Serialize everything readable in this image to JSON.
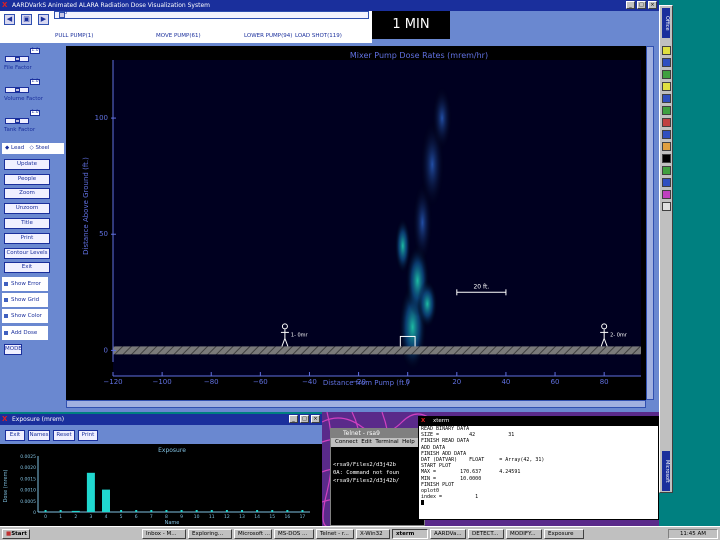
{
  "app": {
    "title": "AARDVarkS Animated ALARA Radiation Dose Visualization System",
    "time_display": "1 MIN",
    "toolbar_icons": [
      "rewind-icon",
      "stop-icon",
      "play-icon"
    ],
    "slider_value": "0",
    "pump_labels": [
      "PULL PUMP(1)",
      "MOVE PUMP(61)",
      "LOWER PUMP(94)",
      "LOAD SHOT(119)"
    ],
    "factors": [
      {
        "label": "File Factor",
        "value": "1.0"
      },
      {
        "label": "Volume Factor",
        "value": "1.0"
      },
      {
        "label": "Tank Factor",
        "value": "1.0"
      }
    ],
    "shielding": {
      "options": [
        "Lead",
        "Steel"
      ],
      "selected": "Lead"
    },
    "buttons": [
      "Update",
      "People",
      "Zoom",
      "Unzoom",
      "Title",
      "Print",
      "Contour Levels",
      "Exit"
    ],
    "checkboxes": [
      "Show Error",
      "Show Grid",
      "Show Color",
      "Add Dose"
    ],
    "mode_button": "MODE"
  },
  "plot": {
    "title": "Mixer Pump Dose Rates (mrem/hr)",
    "xlabel": "Distance from Pump (ft.)",
    "ylabel": "Distance Above Ground (ft.)",
    "scale_bar_label": "20 ft.",
    "person_labels": [
      "1- 0mr",
      "2- 0mr"
    ]
  },
  "chart_data": {
    "type": "heatmap",
    "title": "Mixer Pump Dose Rates (mrem/hr)",
    "xlabel": "Distance from Pump (ft.)",
    "ylabel": "Distance Above Ground (ft.)",
    "xlim": [
      -120,
      95
    ],
    "ylim": [
      -5,
      125
    ],
    "xticks": [
      -120,
      -100,
      -80,
      -60,
      -40,
      -20,
      0,
      20,
      40,
      60,
      80
    ],
    "yticks": [
      0,
      50,
      100
    ],
    "people": [
      {
        "label": "1- 0mr",
        "x": -50,
        "y": 0
      },
      {
        "label": "2- 0mr",
        "x": 80,
        "y": 0
      }
    ],
    "scale_bar": {
      "label": "20 ft.",
      "x_start": 20,
      "x_end": 40,
      "y": 25
    }
  },
  "exposure_window": {
    "title": "Exposure (mrem)",
    "buttons": [
      "Exit",
      "Names",
      "Reset",
      "Print"
    ],
    "chart": {
      "type": "bar",
      "title": "Exposure",
      "xlabel": "Name",
      "ylabel": "Dose (mrem)",
      "categories": [
        0,
        1,
        2,
        3,
        4,
        5,
        6,
        7,
        8,
        9,
        10,
        11,
        12,
        13,
        14,
        15,
        16,
        17
      ],
      "values": [
        0,
        0,
        5e-05,
        0.00175,
        0.001,
        0,
        0,
        0,
        0,
        0,
        0,
        0,
        0,
        0,
        0,
        0,
        0,
        0
      ],
      "ylim": [
        0,
        0.0025
      ],
      "yticks": [
        "0",
        "0.0005",
        "0.0010",
        "0.0015",
        "0.0020",
        "0.0025"
      ]
    }
  },
  "telnet": {
    "title": "Telnet - rsa9",
    "menu": [
      "Connect",
      "Edit",
      "Terminal",
      "Help"
    ],
    "lines": [
      "<rsa9/Files2/d3j42b",
      "0A: Command not foun",
      "<rsa9/Files2/d3j42b/"
    ]
  },
  "xterm": {
    "title": "xterm",
    "lines": [
      "READ BINARY DATA",
      "SIZE =          42           31",
      "FINISH READ DATA",
      "ADD DATA",
      "FINISH ADD DATA",
      "DAT (DATVAR)    FLOAT     = Array(42, 31)",
      "START PLOT",
      "MAX =        170.637      4.24591",
      "MIN =        10.0000",
      "FINISH PLOT",
      "oplot0",
      "index =           1"
    ]
  },
  "office_bar": {
    "label": "Office",
    "footer": "Microsoft"
  },
  "taskbar": {
    "start": "Start",
    "tasks": [
      "Inbox - M...",
      "Exploring...",
      "Microsoft ...",
      "MS-DOS ...",
      "Telnet - r...",
      "X-Win32",
      "xterm",
      "AARDVa...",
      "DETECT...",
      "MODIFY...",
      "Exposure"
    ],
    "clock": "11:45 AM"
  }
}
